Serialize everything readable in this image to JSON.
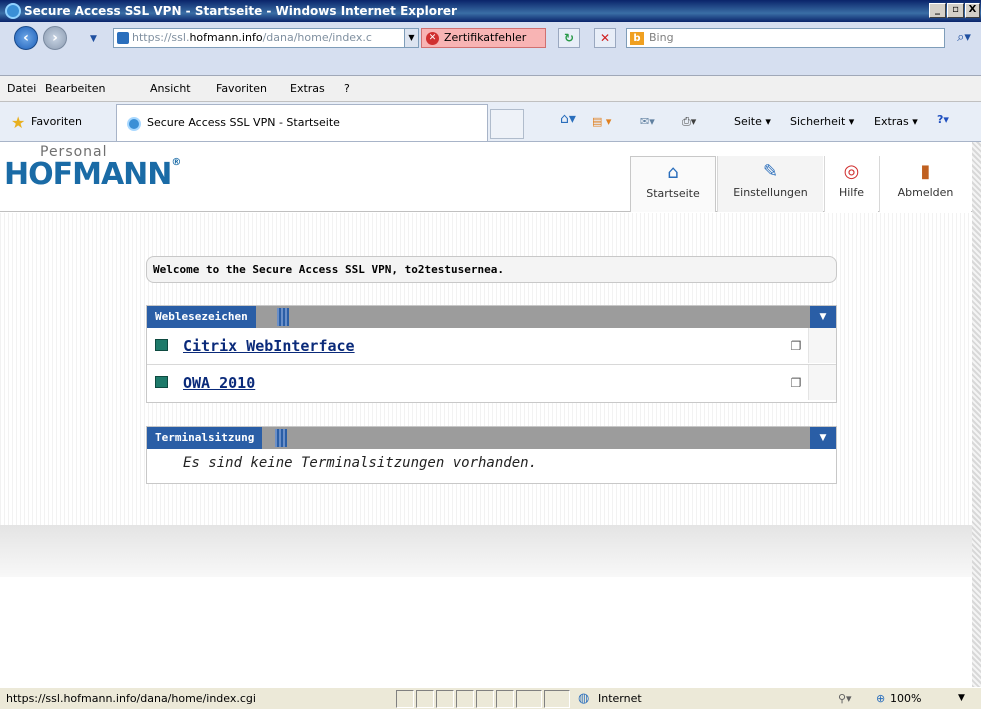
{
  "window": {
    "title": "Secure Access SSL VPN - Startseite - Windows Internet Explorer"
  },
  "address": {
    "url_prefix": "https://ssl.",
    "url_host": "hofmann.info",
    "url_path": "/dana/home/index.c",
    "cert_error": "Zertifikatfehler"
  },
  "search": {
    "placeholder": "Bing"
  },
  "menubar": [
    "Datei",
    "Bearbeiten",
    "Ansicht",
    "Favoriten",
    "Extras",
    "?"
  ],
  "favbar": {
    "label": "Favoriten",
    "tab_title": "Secure Access SSL VPN - Startseite"
  },
  "commandbar": {
    "page": "Seite ▾",
    "security": "Sicherheit ▾",
    "extras": "Extras ▾"
  },
  "logo": {
    "personal": "Personal",
    "name": "HOFMANN",
    "reg": "®"
  },
  "nav": {
    "home": "Startseite",
    "settings": "Einstellungen",
    "help": "Hilfe",
    "logout": "Abmelden"
  },
  "welcome": "Welcome to the Secure Access SSL VPN, to2testusernea.",
  "bookmarks": {
    "title": "Weblesezeichen",
    "items": [
      "Citrix WebInterface",
      "OWA 2010"
    ]
  },
  "terminal": {
    "title": "Terminalsitzung",
    "empty": "Es sind keine Terminalsitzungen vorhanden."
  },
  "status": {
    "url": "https://ssl.hofmann.info/dana/home/index.cgi",
    "zone": "Internet",
    "zoom": "100%"
  },
  "colors": {
    "accent": "#2a5ea6",
    "titlebar": "#0a246a"
  }
}
